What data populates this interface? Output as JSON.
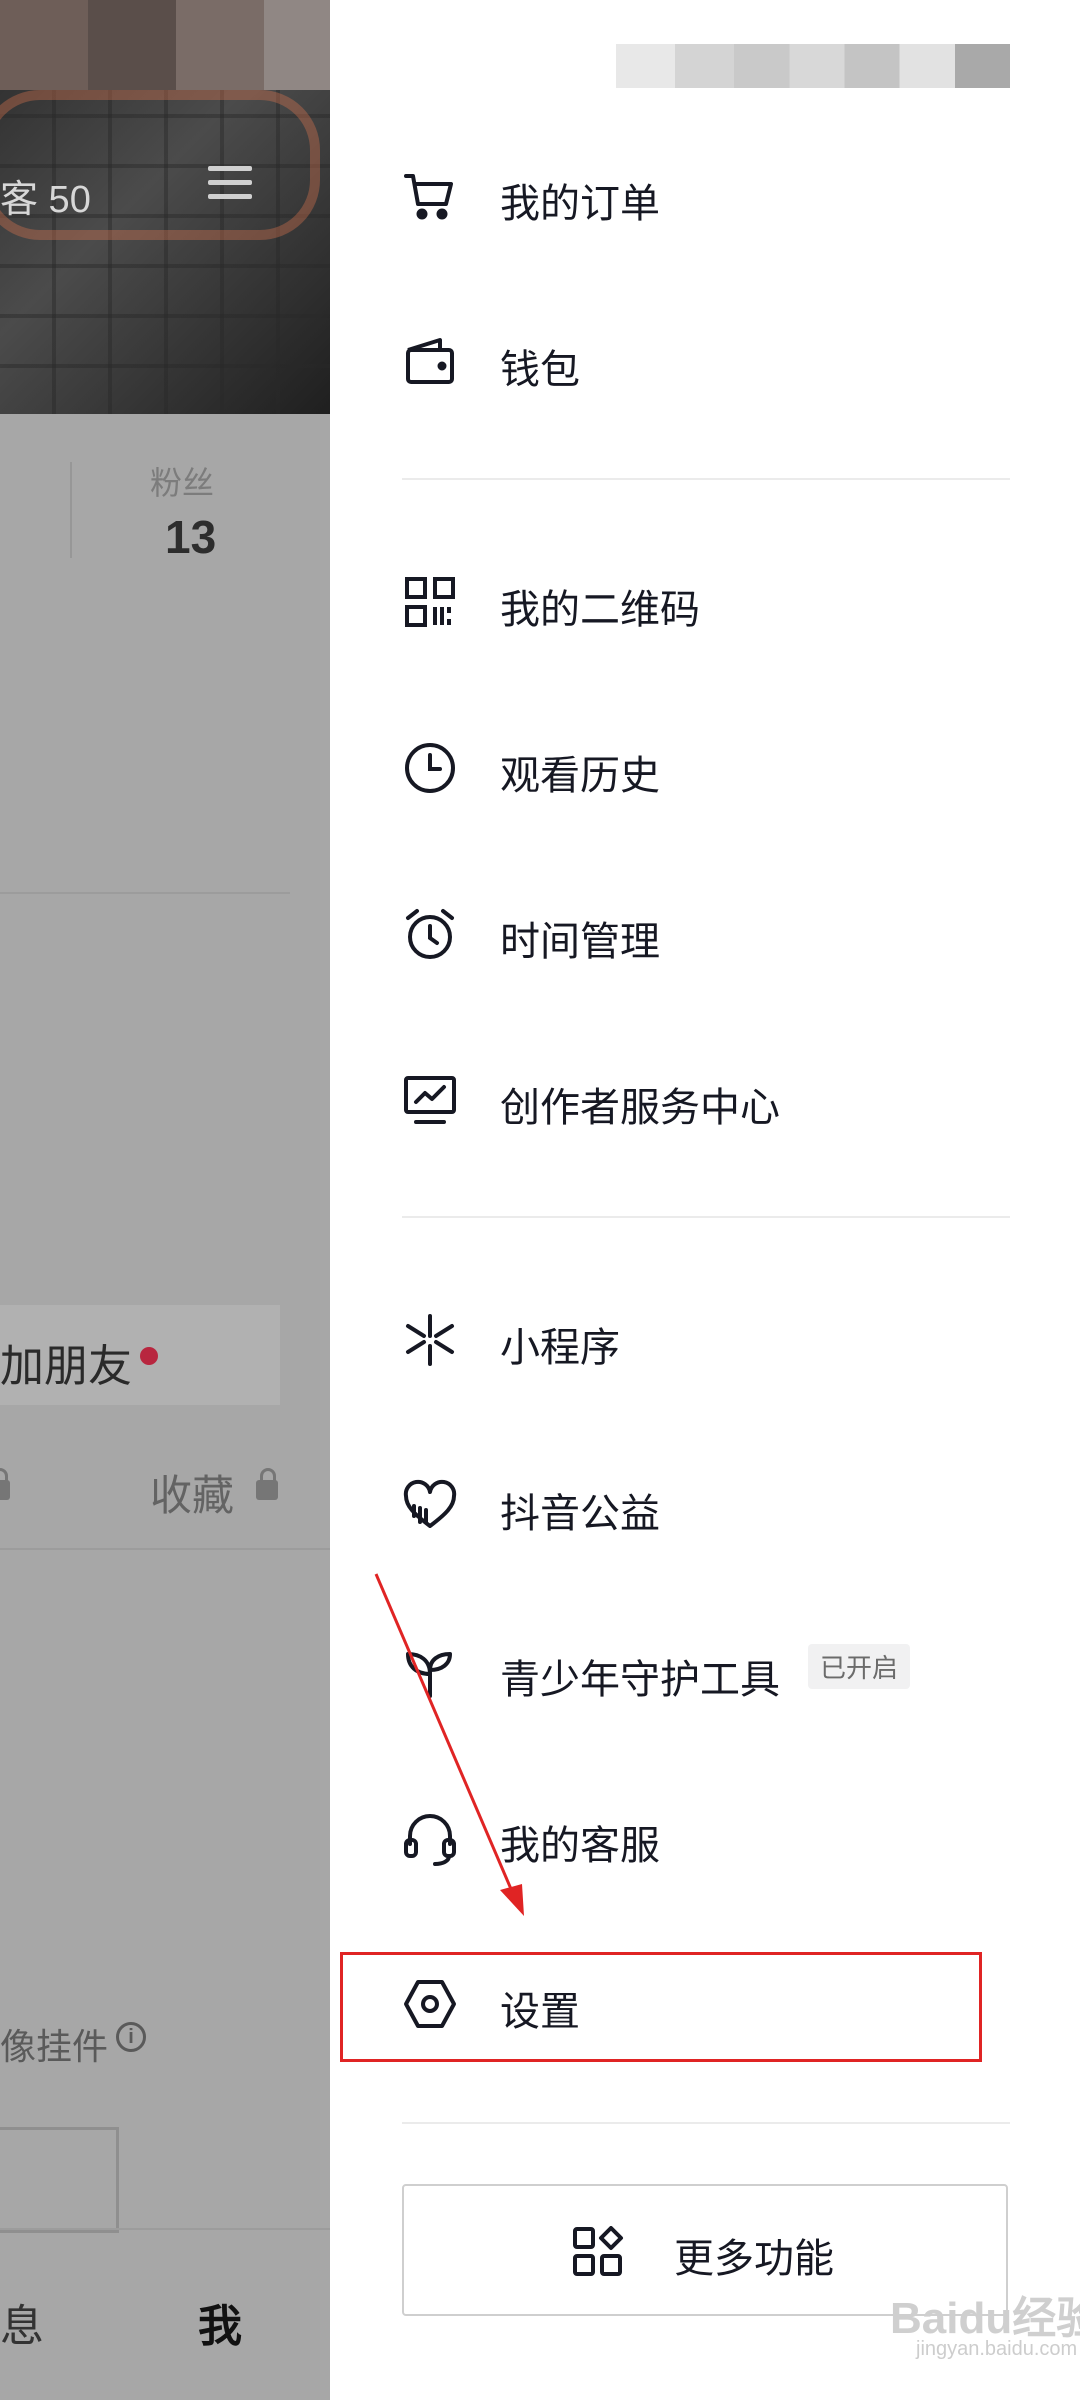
{
  "background": {
    "visitor_text": "客 50",
    "stat_label": "粉丝",
    "stat_value": "13",
    "add_friend": "加朋友",
    "collect": "收藏",
    "widget_text": "像挂件",
    "tab_message": "息",
    "tab_me": "我"
  },
  "drawer": {
    "items": [
      {
        "label": "我的订单",
        "icon": "cart-icon"
      },
      {
        "label": "钱包",
        "icon": "wallet-icon"
      },
      {
        "label": "我的二维码",
        "icon": "qrcode-icon"
      },
      {
        "label": "观看历史",
        "icon": "clock-icon"
      },
      {
        "label": "时间管理",
        "icon": "alarm-icon"
      },
      {
        "label": "创作者服务中心",
        "icon": "monitor-chart-icon"
      },
      {
        "label": "小程序",
        "icon": "mini-program-icon"
      },
      {
        "label": "抖音公益",
        "icon": "heart-icon"
      },
      {
        "label": "青少年守护工具",
        "icon": "sprout-icon",
        "badge": "已开启"
      },
      {
        "label": "我的客服",
        "icon": "headset-icon"
      },
      {
        "label": "设置",
        "icon": "hexagon-settings-icon"
      }
    ],
    "more_button": {
      "label": "更多功能",
      "icon": "grid-shapes-icon"
    }
  },
  "annotation": {
    "color": "#e02424"
  },
  "watermark": {
    "text": "Baidu经验",
    "sub": "jingyan.baidu.com"
  }
}
